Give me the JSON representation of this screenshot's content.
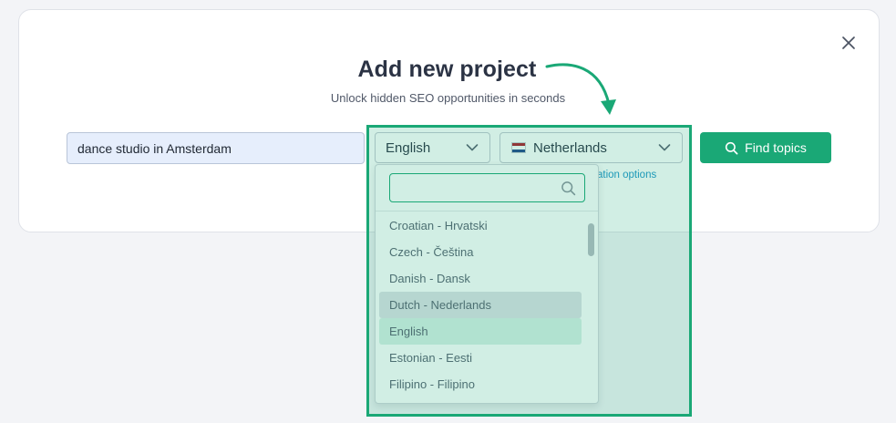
{
  "modal": {
    "title": "Add new project",
    "subtitle": "Unlock hidden SEO opportunities in seconds"
  },
  "form": {
    "keyword_value": "dance studio in Amsterdam",
    "language_selected": "English",
    "country_selected": "Netherlands",
    "country_flag_colors": [
      "#ae1c28",
      "#ffffff",
      "#21468b"
    ],
    "location_options_link": "ation options",
    "find_button_label": "Find topics"
  },
  "dropdown": {
    "search_value": "",
    "items": [
      "Croatian - Hrvatski",
      "Czech - Čeština",
      "Danish - Dansk",
      "Dutch - Nederlands",
      "English",
      "Estonian - Eesti",
      "Filipino - Filipino"
    ],
    "hovered_item": "Dutch - Nederlands",
    "selected_item": "English"
  },
  "colors": {
    "accent": "#1aa876",
    "link": "#1e95c9"
  },
  "icons": [
    "close-icon",
    "chevron-down-icon",
    "search-icon",
    "curved-arrow-icon"
  ]
}
